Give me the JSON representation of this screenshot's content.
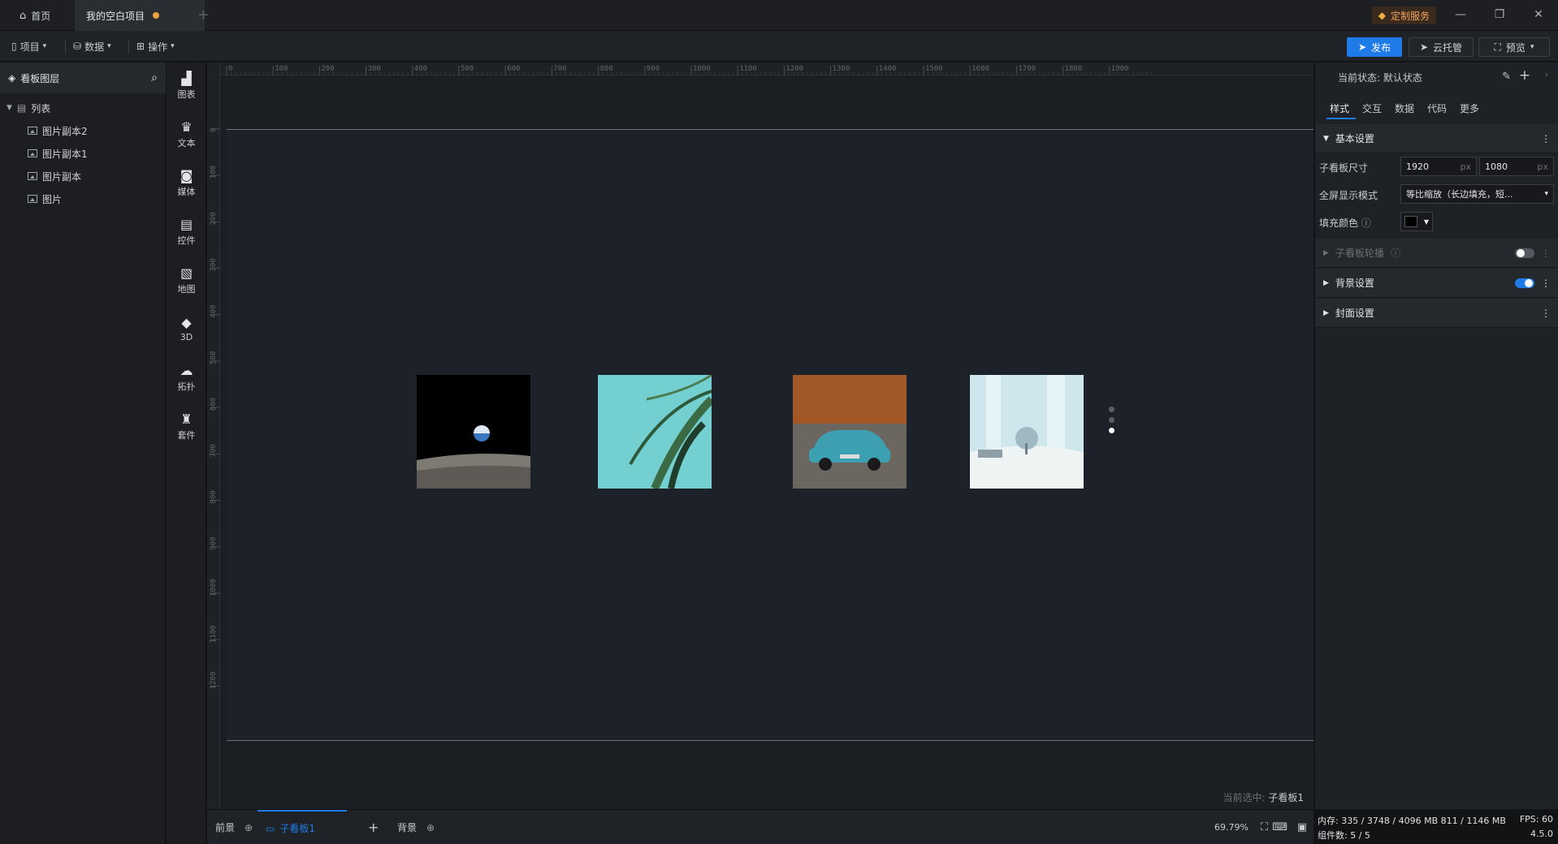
{
  "titlebar": {
    "home_tab": "首页",
    "project_tab": "我的空白项目",
    "custom_service": "定制服务"
  },
  "toolbar": {
    "menus": [
      {
        "label": "项目",
        "icon": "file-icon"
      },
      {
        "label": "数据",
        "icon": "database-icon"
      },
      {
        "label": "操作",
        "icon": "grid-icon"
      }
    ],
    "publish": "发布",
    "cloud": "云托管",
    "preview": "预览"
  },
  "layers": {
    "title": "看板图层",
    "group": "列表",
    "items": [
      "图片副本2",
      "图片副本1",
      "图片副本",
      "图片"
    ]
  },
  "components": [
    "图表",
    "文本",
    "媒体",
    "控件",
    "地图",
    "3D",
    "拓扑",
    "套件"
  ],
  "ruler": {
    "top": [
      "0",
      "100",
      "200",
      "300",
      "400",
      "500",
      "600",
      "700",
      "800",
      "900",
      "1000",
      "1100",
      "1200",
      "1300",
      "1400",
      "1500",
      "1600",
      "1700",
      "1800",
      "1900"
    ],
    "left": [
      "0",
      "100",
      "200",
      "300",
      "400",
      "500",
      "600",
      "700",
      "800",
      "900",
      "1000",
      "1100",
      "1200"
    ]
  },
  "canvas": {
    "current_selected_label": "当前选中:",
    "current_selected_value": "子看板1",
    "carousel_pages": 3,
    "carousel_active_index": 2
  },
  "bottombar": {
    "foreground": "前景",
    "subboard": "子看板1",
    "background": "背景",
    "zoom": "69.79%"
  },
  "props": {
    "state_label": "当前状态:",
    "state_value": "默认状态",
    "tabs": [
      "样式",
      "交互",
      "数据",
      "代码",
      "更多"
    ],
    "active_tab": "样式",
    "basic_settings": "基本设置",
    "size_label": "子看板尺寸",
    "width": "1920",
    "height": "1080",
    "unit": "px",
    "fullscreen_label": "全屏显示模式",
    "fullscreen_value": "等比缩放（长边填充，短...",
    "fill_label": "填充颜色",
    "fill_color": "#000000",
    "sections": [
      {
        "label": "子看板轮播",
        "toggle": false,
        "disabled": true
      },
      {
        "label": "背景设置",
        "toggle": true,
        "disabled": false
      },
      {
        "label": "封面设置",
        "toggle": null,
        "disabled": false
      }
    ]
  },
  "status": {
    "memory_label": "内存:",
    "memory_value": "335 / 3748 / 4096 MB",
    "memory_value2": "811 / 1146 MB",
    "fps_label": "FPS:",
    "fps_value": "60",
    "components_label": "组件数:",
    "components_value": "5 / 5",
    "version": "4.5.0"
  },
  "colors": {
    "accent": "#1e7be8",
    "unsaved_dot": "#e8a33a",
    "custom_service": "#f0a35c"
  }
}
